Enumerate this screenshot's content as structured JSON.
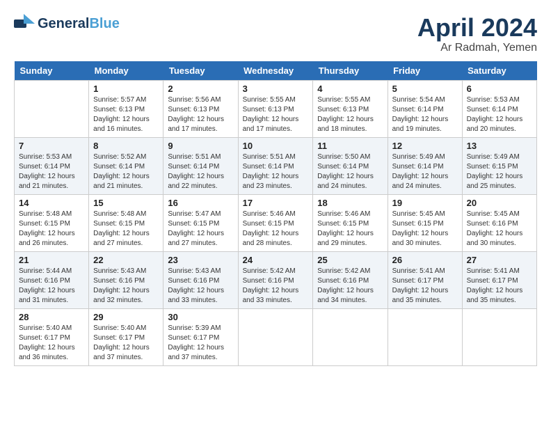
{
  "header": {
    "logo_line1": "General",
    "logo_line2": "Blue",
    "title": "April 2024",
    "location": "Ar Radmah, Yemen"
  },
  "days_of_week": [
    "Sunday",
    "Monday",
    "Tuesday",
    "Wednesday",
    "Thursday",
    "Friday",
    "Saturday"
  ],
  "weeks": [
    [
      {
        "day": "",
        "sunrise": "",
        "sunset": "",
        "daylight": ""
      },
      {
        "day": "1",
        "sunrise": "Sunrise: 5:57 AM",
        "sunset": "Sunset: 6:13 PM",
        "daylight": "Daylight: 12 hours and 16 minutes."
      },
      {
        "day": "2",
        "sunrise": "Sunrise: 5:56 AM",
        "sunset": "Sunset: 6:13 PM",
        "daylight": "Daylight: 12 hours and 17 minutes."
      },
      {
        "day": "3",
        "sunrise": "Sunrise: 5:55 AM",
        "sunset": "Sunset: 6:13 PM",
        "daylight": "Daylight: 12 hours and 17 minutes."
      },
      {
        "day": "4",
        "sunrise": "Sunrise: 5:55 AM",
        "sunset": "Sunset: 6:13 PM",
        "daylight": "Daylight: 12 hours and 18 minutes."
      },
      {
        "day": "5",
        "sunrise": "Sunrise: 5:54 AM",
        "sunset": "Sunset: 6:14 PM",
        "daylight": "Daylight: 12 hours and 19 minutes."
      },
      {
        "day": "6",
        "sunrise": "Sunrise: 5:53 AM",
        "sunset": "Sunset: 6:14 PM",
        "daylight": "Daylight: 12 hours and 20 minutes."
      }
    ],
    [
      {
        "day": "7",
        "sunrise": "Sunrise: 5:53 AM",
        "sunset": "Sunset: 6:14 PM",
        "daylight": "Daylight: 12 hours and 21 minutes."
      },
      {
        "day": "8",
        "sunrise": "Sunrise: 5:52 AM",
        "sunset": "Sunset: 6:14 PM",
        "daylight": "Daylight: 12 hours and 21 minutes."
      },
      {
        "day": "9",
        "sunrise": "Sunrise: 5:51 AM",
        "sunset": "Sunset: 6:14 PM",
        "daylight": "Daylight: 12 hours and 22 minutes."
      },
      {
        "day": "10",
        "sunrise": "Sunrise: 5:51 AM",
        "sunset": "Sunset: 6:14 PM",
        "daylight": "Daylight: 12 hours and 23 minutes."
      },
      {
        "day": "11",
        "sunrise": "Sunrise: 5:50 AM",
        "sunset": "Sunset: 6:14 PM",
        "daylight": "Daylight: 12 hours and 24 minutes."
      },
      {
        "day": "12",
        "sunrise": "Sunrise: 5:49 AM",
        "sunset": "Sunset: 6:14 PM",
        "daylight": "Daylight: 12 hours and 24 minutes."
      },
      {
        "day": "13",
        "sunrise": "Sunrise: 5:49 AM",
        "sunset": "Sunset: 6:15 PM",
        "daylight": "Daylight: 12 hours and 25 minutes."
      }
    ],
    [
      {
        "day": "14",
        "sunrise": "Sunrise: 5:48 AM",
        "sunset": "Sunset: 6:15 PM",
        "daylight": "Daylight: 12 hours and 26 minutes."
      },
      {
        "day": "15",
        "sunrise": "Sunrise: 5:48 AM",
        "sunset": "Sunset: 6:15 PM",
        "daylight": "Daylight: 12 hours and 27 minutes."
      },
      {
        "day": "16",
        "sunrise": "Sunrise: 5:47 AM",
        "sunset": "Sunset: 6:15 PM",
        "daylight": "Daylight: 12 hours and 27 minutes."
      },
      {
        "day": "17",
        "sunrise": "Sunrise: 5:46 AM",
        "sunset": "Sunset: 6:15 PM",
        "daylight": "Daylight: 12 hours and 28 minutes."
      },
      {
        "day": "18",
        "sunrise": "Sunrise: 5:46 AM",
        "sunset": "Sunset: 6:15 PM",
        "daylight": "Daylight: 12 hours and 29 minutes."
      },
      {
        "day": "19",
        "sunrise": "Sunrise: 5:45 AM",
        "sunset": "Sunset: 6:15 PM",
        "daylight": "Daylight: 12 hours and 30 minutes."
      },
      {
        "day": "20",
        "sunrise": "Sunrise: 5:45 AM",
        "sunset": "Sunset: 6:16 PM",
        "daylight": "Daylight: 12 hours and 30 minutes."
      }
    ],
    [
      {
        "day": "21",
        "sunrise": "Sunrise: 5:44 AM",
        "sunset": "Sunset: 6:16 PM",
        "daylight": "Daylight: 12 hours and 31 minutes."
      },
      {
        "day": "22",
        "sunrise": "Sunrise: 5:43 AM",
        "sunset": "Sunset: 6:16 PM",
        "daylight": "Daylight: 12 hours and 32 minutes."
      },
      {
        "day": "23",
        "sunrise": "Sunrise: 5:43 AM",
        "sunset": "Sunset: 6:16 PM",
        "daylight": "Daylight: 12 hours and 33 minutes."
      },
      {
        "day": "24",
        "sunrise": "Sunrise: 5:42 AM",
        "sunset": "Sunset: 6:16 PM",
        "daylight": "Daylight: 12 hours and 33 minutes."
      },
      {
        "day": "25",
        "sunrise": "Sunrise: 5:42 AM",
        "sunset": "Sunset: 6:16 PM",
        "daylight": "Daylight: 12 hours and 34 minutes."
      },
      {
        "day": "26",
        "sunrise": "Sunrise: 5:41 AM",
        "sunset": "Sunset: 6:17 PM",
        "daylight": "Daylight: 12 hours and 35 minutes."
      },
      {
        "day": "27",
        "sunrise": "Sunrise: 5:41 AM",
        "sunset": "Sunset: 6:17 PM",
        "daylight": "Daylight: 12 hours and 35 minutes."
      }
    ],
    [
      {
        "day": "28",
        "sunrise": "Sunrise: 5:40 AM",
        "sunset": "Sunset: 6:17 PM",
        "daylight": "Daylight: 12 hours and 36 minutes."
      },
      {
        "day": "29",
        "sunrise": "Sunrise: 5:40 AM",
        "sunset": "Sunset: 6:17 PM",
        "daylight": "Daylight: 12 hours and 37 minutes."
      },
      {
        "day": "30",
        "sunrise": "Sunrise: 5:39 AM",
        "sunset": "Sunset: 6:17 PM",
        "daylight": "Daylight: 12 hours and 37 minutes."
      },
      {
        "day": "",
        "sunrise": "",
        "sunset": "",
        "daylight": ""
      },
      {
        "day": "",
        "sunrise": "",
        "sunset": "",
        "daylight": ""
      },
      {
        "day": "",
        "sunrise": "",
        "sunset": "",
        "daylight": ""
      },
      {
        "day": "",
        "sunrise": "",
        "sunset": "",
        "daylight": ""
      }
    ]
  ]
}
